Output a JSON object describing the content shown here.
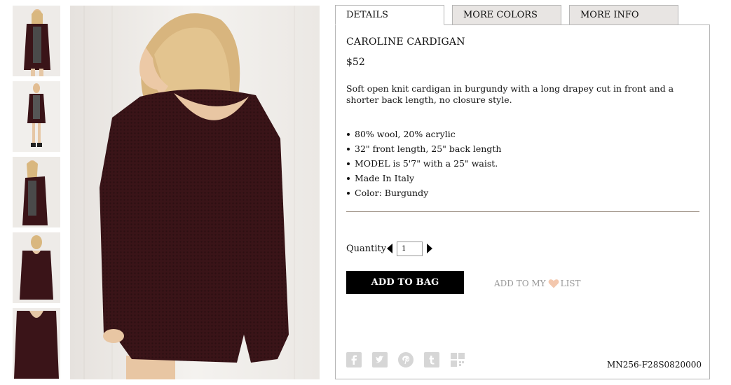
{
  "tabs": [
    {
      "label": "DETAILS",
      "active": true
    },
    {
      "label": "MORE COLORS",
      "active": false
    },
    {
      "label": "MORE INFO",
      "active": false
    }
  ],
  "product": {
    "title": "CAROLINE CARDIGAN",
    "price": "$52",
    "description": "Soft open knit cardigan in burgundy with a long drapey cut in front and a shorter back length, no closure style.",
    "features": [
      "80% wool, 20% acrylic",
      "32\" front length, 25\" back length",
      "MODEL is 5'7\" with a 25\" waist.",
      "Made In Italy",
      "Color: Burgundy"
    ],
    "sku": "MN256-F28S0820000",
    "color_swatch": "#3a1418"
  },
  "purchase": {
    "quantity_label": "Quantity",
    "quantity_value": "1",
    "add_to_bag_label": "ADD TO BAG",
    "wishlist_prefix": "ADD TO MY",
    "wishlist_suffix": "LIST"
  },
  "social_icons": [
    "facebook-icon",
    "twitter-icon",
    "pinterest-icon",
    "tumblr-icon",
    "share-icon"
  ],
  "colors": {
    "accent_heart": "#f3c7ad",
    "garment": "#3a1418",
    "social_gray": "#d6d6d6"
  }
}
